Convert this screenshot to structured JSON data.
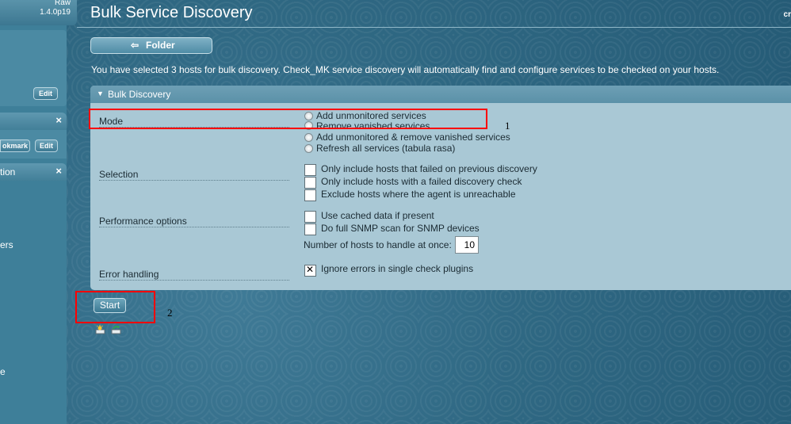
{
  "sidebar": {
    "version_edition": "Raw",
    "version_number": "1.4.0p19",
    "edit_label": "Edit",
    "bookmark_label": "okmark",
    "close_glyph": "×",
    "section_title": "tion",
    "item_partial_1": "ers",
    "item_partial_2": "e"
  },
  "header": {
    "title": "Bulk Service Discovery",
    "user_partial": "cr"
  },
  "toolbar": {
    "folder_arrow": "⇦",
    "folder_label": "Folder"
  },
  "info_text": "You have selected 3 hosts for bulk discovery. Check_MK service discovery will automatically find and configure services to be checked on your hosts.",
  "panel": {
    "title": "Bulk Discovery",
    "mode": {
      "label": "Mode",
      "options": [
        "Add unmonitored services",
        "Remove vanished services",
        "Add unmonitored & remove vanished services",
        "Refresh all services (tabula rasa)"
      ],
      "selected_index": 0
    },
    "selection": {
      "label": "Selection",
      "options": [
        {
          "label": "Only include hosts that failed on previous discovery",
          "checked": false
        },
        {
          "label": "Only include hosts with a failed discovery check",
          "checked": false
        },
        {
          "label": "Exclude hosts where the agent is unreachable",
          "checked": false
        }
      ]
    },
    "performance": {
      "label": "Performance options",
      "options": [
        {
          "label": "Use cached data if present",
          "checked": false
        },
        {
          "label": "Do full SNMP scan for SNMP devices",
          "checked": false
        }
      ],
      "hosts_at_once_label": "Number of hosts to handle at once:",
      "hosts_at_once_value": "10"
    },
    "error_handling": {
      "label": "Error handling",
      "option": {
        "label": "Ignore errors in single check plugins",
        "checked": true
      }
    }
  },
  "actions": {
    "start_label": "Start"
  },
  "annotations": {
    "marker_1": "1",
    "marker_2": "2"
  },
  "colors": {
    "annotation_red": "#ff0000",
    "panel_bg": "#a9c8d5",
    "page_bg": "#2f6883"
  }
}
